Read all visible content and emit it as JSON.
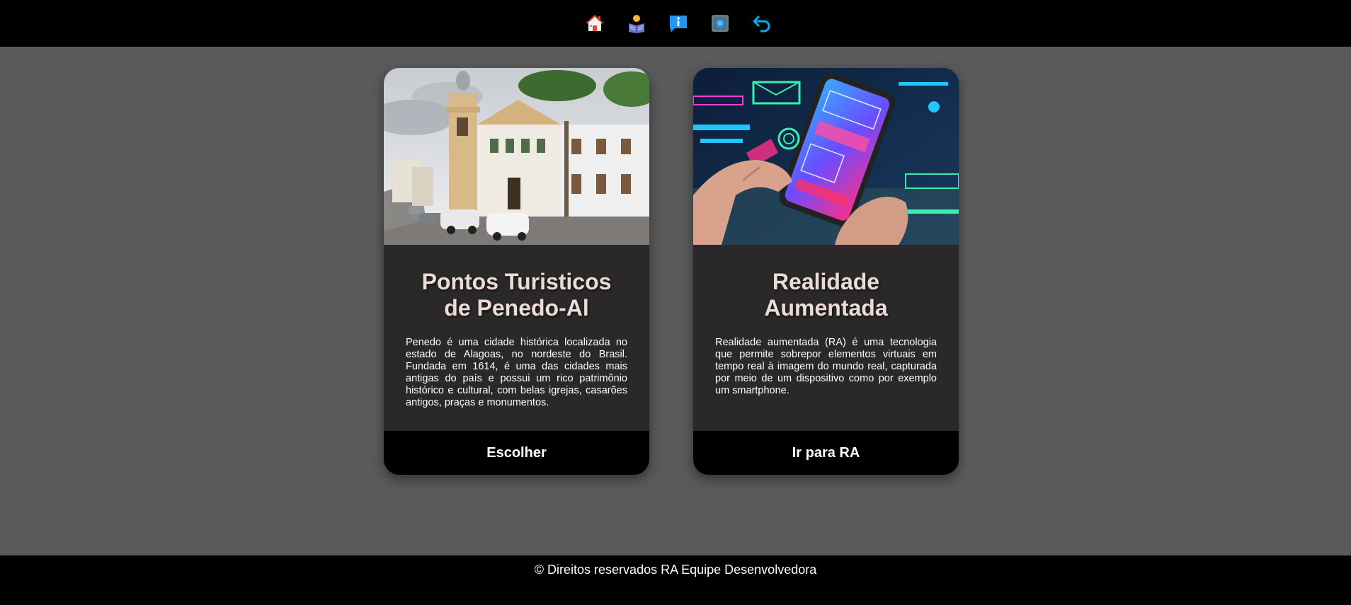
{
  "nav": {
    "items": [
      {
        "icon": "home-icon"
      },
      {
        "icon": "reader-icon"
      },
      {
        "icon": "info-icon"
      },
      {
        "icon": "camera-icon"
      },
      {
        "icon": "back-arrow-icon"
      }
    ]
  },
  "cards": [
    {
      "title": "Pontos Turisticos de Penedo-Al",
      "text": "Penedo é uma cidade histórica localizada no estado de Alagoas, no nordeste do Brasil. Fundada em 1614, é uma das cidades mais antigas do país e possui um rico patrimônio histórico e cultural, com belas igrejas, casarões antigos, praças e monumentos.",
      "button": "Escolher"
    },
    {
      "title": "Realidade Aumentada",
      "text": "Realidade aumentada (RA) é uma tecnologia que permite sobrepor elementos virtuais em tempo real à imagem do mundo real, capturada por meio de um dispositivo como por exemplo um smartphone.",
      "button": "Ir para RA"
    }
  ],
  "footer": {
    "text": "© Direitos reservados RA Equipe Desenvolvedora"
  },
  "colors": {
    "background": "#5a5a5a",
    "card": "#2a2828",
    "bar": "#000000",
    "title": "#ecdcd8"
  }
}
